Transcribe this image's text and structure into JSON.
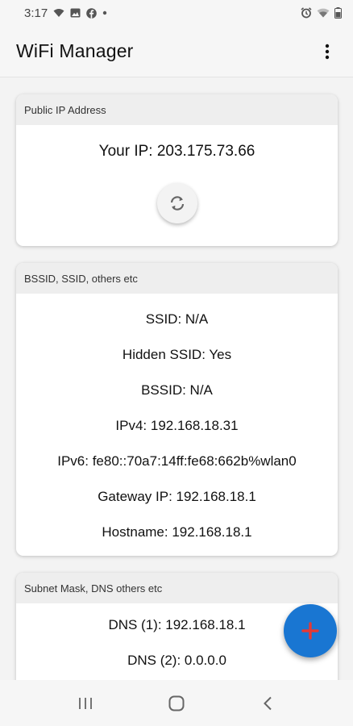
{
  "status_bar": {
    "time": "3:17",
    "left_icons": [
      "wifi-icon",
      "image-icon",
      "facebook-icon",
      "dot-icon"
    ],
    "right_icons": [
      "alarm-icon",
      "wifi-signal-icon",
      "battery-icon"
    ]
  },
  "app_bar": {
    "title": "WiFi Manager",
    "menu_icon": "more-vert-icon"
  },
  "cards": {
    "public_ip": {
      "header": "Public IP Address",
      "ip_text": "Your IP: 203.175.73.66",
      "refresh_icon": "refresh-icon"
    },
    "bssid": {
      "header": "BSSID, SSID, others etc",
      "lines": [
        "SSID: N/A",
        "Hidden SSID: Yes",
        "BSSID: N/A",
        "IPv4: 192.168.18.31",
        "IPv6: fe80::70a7:14ff:fe68:662b%wlan0",
        "Gateway IP: 192.168.18.1",
        "Hostname: 192.168.18.1"
      ]
    },
    "subnet": {
      "header": "Subnet Mask, DNS others etc",
      "lines": [
        "DNS (1): 192.168.18.1",
        "DNS (2): 0.0.0.0"
      ]
    }
  },
  "fab": {
    "icon": "plus-icon"
  },
  "nav_bar": {
    "icons": [
      "recent-apps-icon",
      "home-icon",
      "back-icon"
    ]
  },
  "colors": {
    "accent": "#1976d2",
    "fab_plus": "#e53935",
    "card_header_bg": "#eeeeee",
    "background": "#f3f3f3"
  }
}
